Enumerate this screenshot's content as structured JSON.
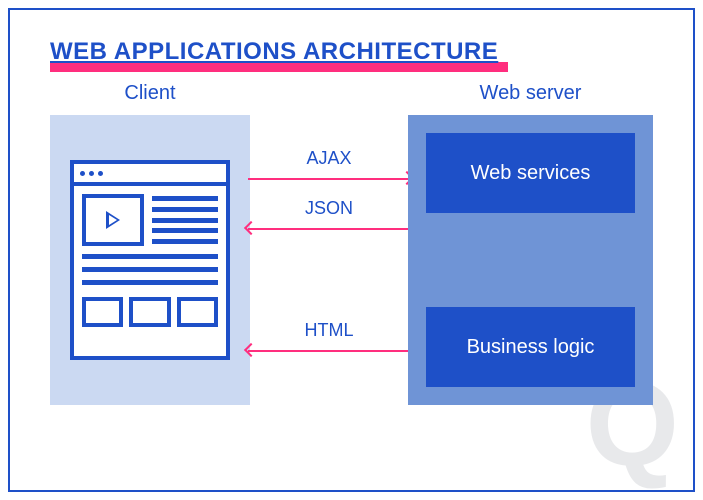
{
  "title": "WEB APPLICATIONS ARCHITECTURE",
  "client": {
    "label": "Client"
  },
  "server": {
    "label": "Web server",
    "items": {
      "web_services": "Web services",
      "business_logic": "Business logic"
    }
  },
  "connections": {
    "ajax": "AJAX",
    "json": "JSON",
    "html": "HTML"
  },
  "watermark": "Q",
  "colors": {
    "primary": "#1e50c8",
    "accent": "#ff2e7e",
    "client_bg": "#cbd9f2",
    "server_bg": "#6f94d6"
  }
}
